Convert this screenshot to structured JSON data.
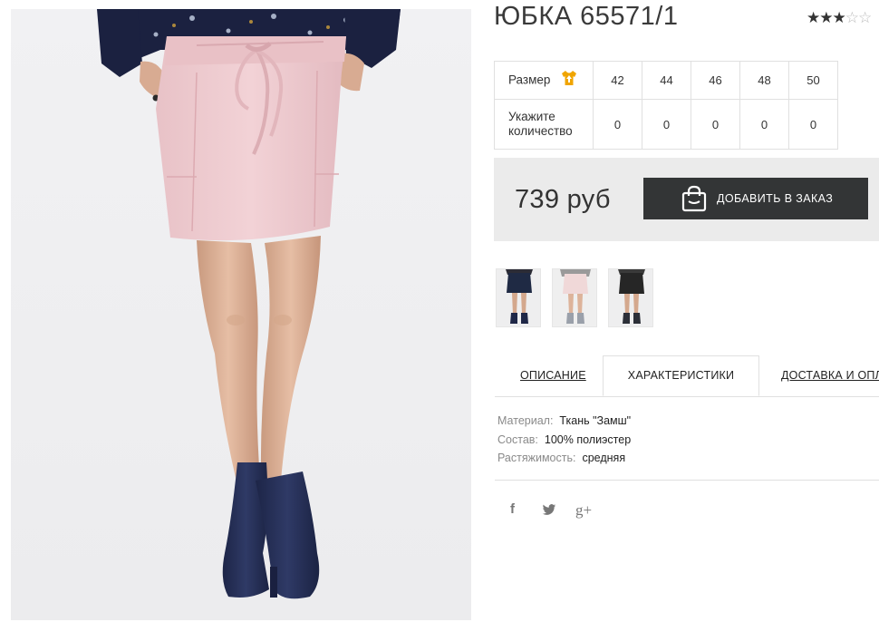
{
  "product": {
    "title": "ЮБКА 65571/1",
    "rating": {
      "filled_stars": 3,
      "total_stars": 5
    }
  },
  "size_table": {
    "size_label": "Размер",
    "size_icon": "tshirt-icon",
    "sizes": [
      "42",
      "44",
      "46",
      "48",
      "50"
    ],
    "quantity_label": "Укажите количество",
    "quantities": [
      "0",
      "0",
      "0",
      "0",
      "0"
    ]
  },
  "purchase": {
    "price": "739 руб",
    "add_button_label": "ДОБАВИТЬ В ЗАКАЗ",
    "add_button_icon": "shopping-bag-icon"
  },
  "thumbnails": [
    {
      "name": "skirt-navy",
      "color": "#1f2a44"
    },
    {
      "name": "skirt-pink",
      "color": "#eed5d5"
    },
    {
      "name": "skirt-black",
      "color": "#262626"
    }
  ],
  "tabs": {
    "items": [
      "ОПИСАНИЕ",
      "ХАРАКТЕРИСТИКИ",
      "ДОСТАВКА И ОПЛАТА"
    ],
    "active_index": 1
  },
  "specs": [
    {
      "label": "Материал:",
      "value": "Ткань \"Замш\""
    },
    {
      "label": "Состав:",
      "value": "100% полиэстер"
    },
    {
      "label": "Растяжимость:",
      "value": "средняя"
    }
  ],
  "social": {
    "facebook": "f",
    "twitter": "twitter-icon",
    "googleplus": "g+"
  },
  "colors": {
    "button_bg": "#333536",
    "price_box_bg": "#ebebeb",
    "size_icon": "#f0a500",
    "skirt": "#efc9ce",
    "boots": "#27315a"
  }
}
